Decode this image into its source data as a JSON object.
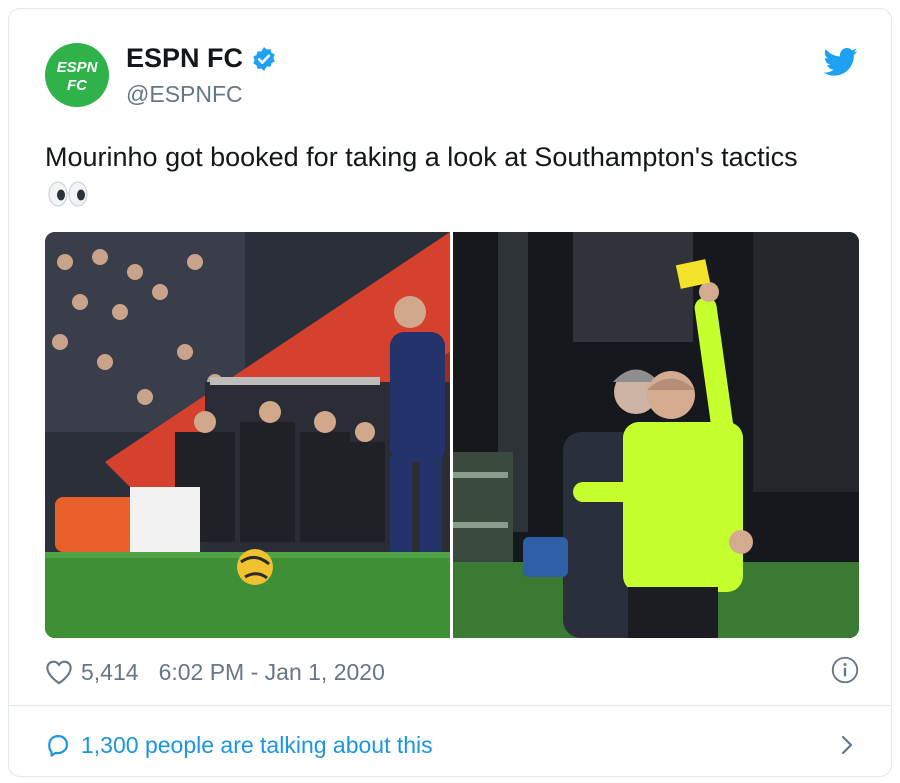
{
  "account": {
    "name": "ESPN FC",
    "handle": "@ESPNFC",
    "logo_text_top": "ESPN",
    "logo_text_bottom": "FC"
  },
  "tweet": {
    "text": "Mourinho got booked for taking a look at Southampton's tactics",
    "emoji": "eyes-emoji"
  },
  "media": {
    "left_photo": "match-sideline-photo",
    "right_photo": "referee-yellow-card-photo"
  },
  "stats": {
    "likes": "5,414",
    "timestamp": "6:02 PM - Jan 1, 2020"
  },
  "footer": {
    "talking": "1,300 people are talking about this"
  },
  "colors": {
    "brand_green": "#2fb24a",
    "twitter_blue": "#1da1f2",
    "link_blue": "#1b95e0",
    "muted": "#657786"
  },
  "icons": [
    "verified-badge-icon",
    "twitter-bird-icon",
    "heart-icon",
    "info-icon",
    "reply-bubble-icon",
    "chevron-right-icon"
  ]
}
